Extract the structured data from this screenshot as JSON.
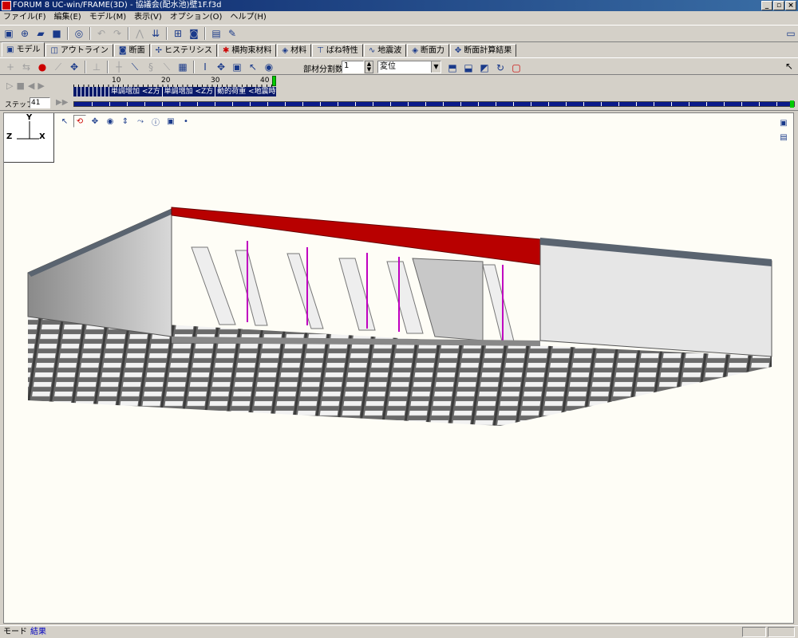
{
  "window": {
    "title": "FORUM 8  UC-win/FRAME(3D) - 協議会(配水池)壁1F.f3d",
    "btn_min": "_",
    "btn_max": "▫",
    "btn_close": "×"
  },
  "menu": [
    "ファイル(F)",
    "編集(E)",
    "モデル(M)",
    "表示(V)",
    "オプション(O)",
    "ヘルプ(H)"
  ],
  "tabs": [
    {
      "label": "モデル",
      "icon": "model-icon"
    },
    {
      "label": "アウトライン",
      "icon": "outline-icon"
    },
    {
      "label": "断面",
      "icon": "section-icon"
    },
    {
      "label": "ヒステリシス",
      "icon": "hysteresis-icon"
    },
    {
      "label": "横拘束材料",
      "icon": "confinement-icon"
    },
    {
      "label": "材料",
      "icon": "material-icon"
    },
    {
      "label": "ばね特性",
      "icon": "spring-icon"
    },
    {
      "label": "地震波",
      "icon": "wave-icon"
    },
    {
      "label": "断面力",
      "icon": "force-icon"
    },
    {
      "label": "断面計算結果",
      "icon": "result-icon"
    }
  ],
  "toolbar2": {
    "division_label": "部材分割数",
    "division_value": "1",
    "display_select": "変位"
  },
  "animation": {
    "ruler_labels": [
      "10",
      "20",
      "30",
      "40"
    ],
    "timeline_segments": [
      "",
      "",
      "",
      "",
      "",
      "",
      "",
      "",
      "",
      "単調増加 <Z方",
      "単調増加 <Z方",
      "動的荷重 <地震時検"
    ],
    "step_label": "ステップ*",
    "step_value": "41",
    "current_step": 41
  },
  "viewport": {
    "axis_y": "Y",
    "axis_z": "Z",
    "axis_x": "X"
  },
  "status": {
    "mode_label": "モード",
    "mode_value": "結果"
  },
  "colors": {
    "accent_red": "#cc0000",
    "timeline_blue": "#0a1a6a",
    "member_magenta": "#c000c0"
  }
}
